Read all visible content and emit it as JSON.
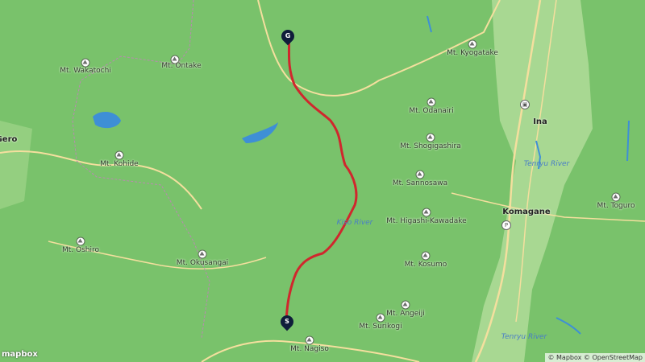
{
  "colors": {
    "land": "#79c26b",
    "valley": "#a8d892",
    "road": "#f4df9e",
    "water": "#3e8fd6",
    "route": "#d0272d",
    "marker": "#0f1d3a"
  },
  "peaks": [
    {
      "name": "Mt. Ontake"
    },
    {
      "name": "Mt. Wakatochi"
    },
    {
      "name": "Mt. Kohide"
    },
    {
      "name": "Mt. Oshiro"
    },
    {
      "name": "Mt. Okusangai"
    },
    {
      "name": "Mt. Kyogatake"
    },
    {
      "name": "Mt. Odanairi"
    },
    {
      "name": "Mt. Shogigashira"
    },
    {
      "name": "Mt. Sannosawa"
    },
    {
      "name": "Mt. Higashi-Kawadake"
    },
    {
      "name": "Mt. Kosumo"
    },
    {
      "name": "Mt. Angeiji"
    },
    {
      "name": "Mt. Surikogi"
    },
    {
      "name": "Mt. Nagiso"
    },
    {
      "name": "Mt. Toguro"
    }
  ],
  "cities": {
    "ina": "Ina",
    "komagane": "Komagane",
    "gero": "Gero"
  },
  "rivers": {
    "kiso": "Kiso River",
    "tenryu": "Tenryu River",
    "tenryu2": "Tenryu River"
  },
  "markers": {
    "start": "S",
    "goal": "G"
  },
  "attribution": "© Mapbox © OpenStreetMap",
  "logo": "mapbox"
}
